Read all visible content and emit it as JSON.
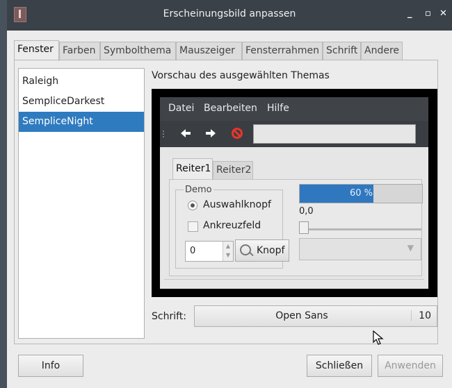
{
  "window": {
    "title": "Erscheinungsbild anpassen",
    "minimize": "_",
    "maximize": "▫",
    "close": "✕"
  },
  "tabs": [
    "Fenster",
    "Farben",
    "Symbolthema",
    "Mauszeiger",
    "Fensterrahmen",
    "Schrift",
    "Andere"
  ],
  "active_tab": "Fenster",
  "themes": [
    "Raleigh",
    "SempliceDarkest",
    "SempliceNight"
  ],
  "selected_theme": "SempliceNight",
  "preview": {
    "title": "Vorschau des ausgewählten Themas",
    "menu": [
      "Datei",
      "Bearbeiten",
      "Hilfe"
    ],
    "toolbar_icons": [
      "arrow-left-icon",
      "arrow-right-icon",
      "stop-icon"
    ],
    "tabs": [
      "Reiter1",
      "Reiter2"
    ],
    "frame_label": "Demo",
    "radio_label": "Auswahlknopf",
    "checkbox_label": "Ankreuzfeld",
    "spin_value": "0",
    "button_label": "Knopf",
    "progress_text": "60 %",
    "progress_value": 0.6,
    "scale_value": "0,0"
  },
  "font": {
    "label": "Schrift:",
    "name": "Open Sans",
    "size": "10"
  },
  "buttons": {
    "info": "Info",
    "close": "Schließen",
    "apply": "Anwenden"
  },
  "colors": {
    "accent": "#2f7bc0",
    "titlebar": "#3a4149"
  }
}
